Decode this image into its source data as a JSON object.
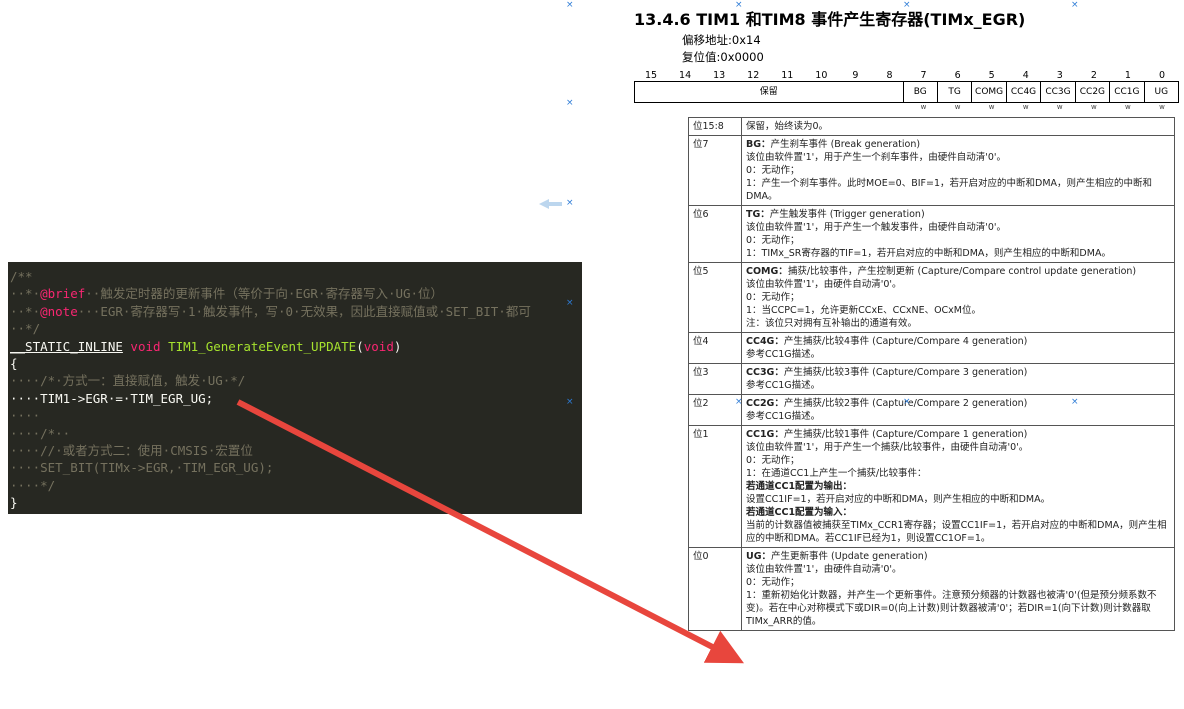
{
  "doc": {
    "title": "13.4.6 TIM1 和TIM8 事件产生寄存器(TIMx_EGR)",
    "offset": "偏移地址:0x14",
    "reset": "复位值:0x0000",
    "bit_numbers": [
      "15",
      "14",
      "13",
      "12",
      "11",
      "10",
      "9",
      "8",
      "7",
      "6",
      "5",
      "4",
      "3",
      "2",
      "1",
      "0"
    ],
    "reserved_label": "保留",
    "bits": [
      "BG",
      "TG",
      "COMG",
      "CC4G",
      "CC3G",
      "CC2G",
      "CC1G",
      "UG"
    ],
    "access": [
      "w",
      "w",
      "w",
      "w",
      "w",
      "w",
      "w",
      "w"
    ],
    "rows": [
      {
        "bit": "位15:8",
        "lines": [
          {
            "t": "保留，始终读为0。"
          }
        ]
      },
      {
        "bit": "位7",
        "lines": [
          {
            "b": "BG：",
            "t": "产生刹车事件 (Break generation)"
          },
          {
            "t": "该位由软件置'1'，用于产生一个刹车事件，由硬件自动清'0'。"
          },
          {
            "t": "0：无动作；"
          },
          {
            "t": "1：产生一个刹车事件。此时MOE=0、BIF=1，若开启对应的中断和DMA，则产生相应的中断和DMA。"
          }
        ]
      },
      {
        "bit": "位6",
        "lines": [
          {
            "b": "TG：",
            "t": "产生触发事件 (Trigger generation)"
          },
          {
            "t": "该位由软件置'1'，用于产生一个触发事件，由硬件自动清'0'。"
          },
          {
            "t": "0：无动作；"
          },
          {
            "t": "1：TIMx_SR寄存器的TIF=1，若开启对应的中断和DMA，则产生相应的中断和DMA。"
          }
        ]
      },
      {
        "bit": "位5",
        "lines": [
          {
            "b": "COMG：",
            "t": "捕获/比较事件，产生控制更新 (Capture/Compare control update generation)"
          },
          {
            "t": "该位由软件置'1'，由硬件自动清'0'。"
          },
          {
            "t": "0：无动作；"
          },
          {
            "t": "1：当CCPC=1，允许更新CCxE、CCxNE、OCxM位。"
          },
          {
            "t": "注：该位只对拥有互补输出的通道有效。"
          }
        ]
      },
      {
        "bit": "位4",
        "lines": [
          {
            "b": "CC4G：",
            "t": "产生捕获/比较4事件 (Capture/Compare 4 generation)"
          },
          {
            "t": "参考CC1G描述。"
          }
        ]
      },
      {
        "bit": "位3",
        "lines": [
          {
            "b": "CC3G：",
            "t": "产生捕获/比较3事件 (Capture/Compare 3 generation)"
          },
          {
            "t": "参考CC1G描述。"
          }
        ]
      },
      {
        "bit": "位2",
        "lines": [
          {
            "b": "CC2G：",
            "t": "产生捕获/比较2事件 (Capture/Compare 2 generation)"
          },
          {
            "t": "参考CC1G描述。"
          }
        ]
      },
      {
        "bit": "位1",
        "lines": [
          {
            "b": "CC1G：",
            "t": "产生捕获/比较1事件 (Capture/Compare 1 generation)"
          },
          {
            "t": "该位由软件置'1'，用于产生一个捕获/比较事件，由硬件自动清'0'。"
          },
          {
            "t": "0：无动作；"
          },
          {
            "t": "1：在通道CC1上产生一个捕获/比较事件："
          },
          {
            "b": "若通道CC1配置为输出：",
            "t": ""
          },
          {
            "t": "设置CC1IF=1，若开启对应的中断和DMA，则产生相应的中断和DMA。"
          },
          {
            "b": "若通道CC1配置为输入：",
            "t": ""
          },
          {
            "t": "当前的计数器值被捕获至TIMx_CCR1寄存器；设置CC1IF=1，若开启对应的中断和DMA，则产生相应的中断和DMA。若CC1IF已经为1，则设置CC1OF=1。"
          }
        ]
      },
      {
        "bit": "位0",
        "lines": [
          {
            "b": "UG：",
            "t": "产生更新事件 (Update generation)"
          },
          {
            "t": "该位由软件置'1'，由硬件自动清'0'。"
          },
          {
            "t": "0：无动作；"
          },
          {
            "t": "1：重新初始化计数器，并产生一个更新事件。注意预分频器的计数器也被清'0'(但是预分频系数不变)。若在中心对称模式下或DIR=0(向上计数)则计数器被清'0'；若DIR=1(向下计数)则计数器取TIMx_ARR的值。"
          }
        ]
      }
    ]
  },
  "code": {
    "l1": "/**",
    "l2a": "··*·",
    "l2b": "@brief",
    "l2c": "··触发定时器的更新事件（等价于向·EGR·寄存器写入·UG·位）",
    "l3a": "··*·",
    "l3b": "@note",
    "l3c": "···EGR·寄存器写·1·触发事件，写·0·无效果，因此直接赋值或·SET_BIT·都可",
    "l4": "··*/",
    "l5a": "__STATIC_INLINE",
    "l5b": "void",
    "l5c": "TIM1_GenerateEvent_UPDATE",
    "l5d": "(",
    "l5e": "void",
    "l5f": ")",
    "l6": "{",
    "l7": "····/*·方式一：直接赋值，触发·UG·*/",
    "l8": "····TIM1->EGR·=·TIM_EGR_UG;",
    "l9": "····",
    "l10": "····/*··",
    "l11": "····//·或者方式二：使用·CMSIS·宏置位",
    "l12": "····SET_BIT(TIMx->EGR,·TIM_EGR_UG);",
    "l13": "····*/",
    "l14": "}"
  },
  "annotation": {
    "arrow_color": "#e8463d",
    "marker_glyph": "×"
  }
}
